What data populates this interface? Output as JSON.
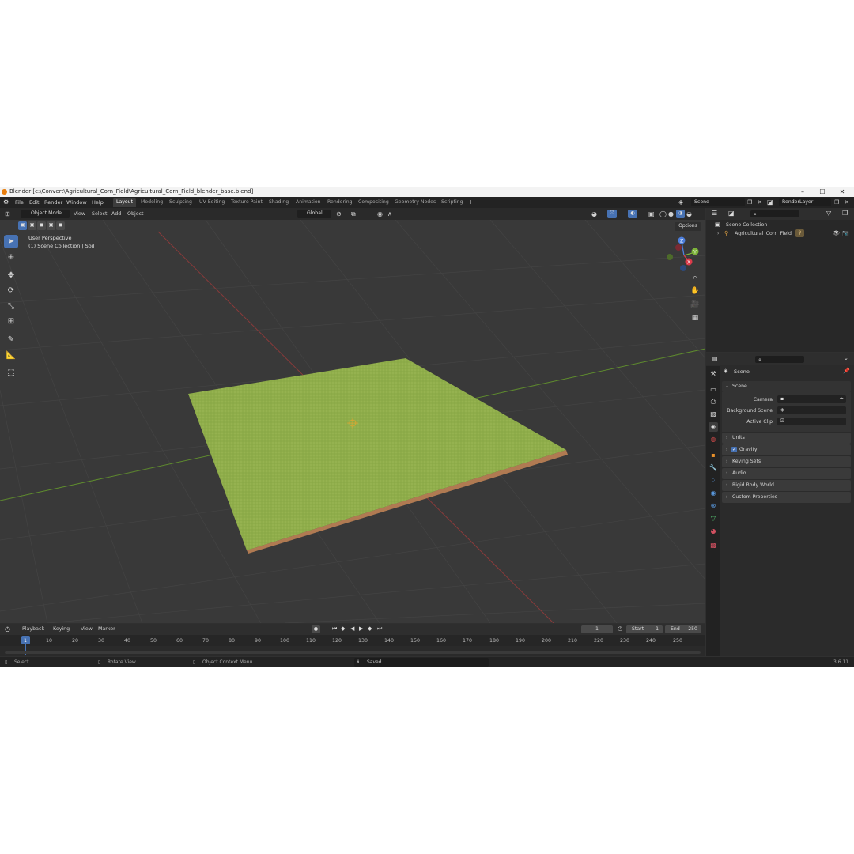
{
  "window": {
    "title": "Blender [c:\\Convert\\Agricultural_Corn_Field\\Agricultural_Corn_Field_blender_base.blend]",
    "minimize": "–",
    "maximize": "☐",
    "close": "✕"
  },
  "menu": [
    "File",
    "Edit",
    "Render",
    "Window",
    "Help"
  ],
  "workspaces": [
    {
      "label": "Layout",
      "active": true
    },
    {
      "label": "Modeling",
      "active": false
    },
    {
      "label": "Sculpting",
      "active": false
    },
    {
      "label": "UV Editing",
      "active": false
    },
    {
      "label": "Texture Paint",
      "active": false
    },
    {
      "label": "Shading",
      "active": false
    },
    {
      "label": "Animation",
      "active": false
    },
    {
      "label": "Rendering",
      "active": false
    },
    {
      "label": "Compositing",
      "active": false
    },
    {
      "label": "Geometry Nodes",
      "active": false
    },
    {
      "label": "Scripting",
      "active": false
    }
  ],
  "add_workspace": "+",
  "scene_selector": "Scene",
  "view_layer_selector": "RenderLayer",
  "viewport": {
    "mode": "Object Mode",
    "menus": [
      "View",
      "Select",
      "Add",
      "Object"
    ],
    "transform_orientation": "Global",
    "options_label": "Options",
    "overlay_line1": "User Perspective",
    "overlay_line2": "(1) Scene Collection | Soil",
    "gizmo": {
      "z": "Z",
      "y": "Y",
      "x": "X"
    }
  },
  "outliner": {
    "root": "Scene Collection",
    "items": [
      {
        "label": "Agricultural_Corn_Field"
      }
    ]
  },
  "properties": {
    "header": "Scene",
    "panel_title": "Scene",
    "fields": [
      {
        "label": "Camera",
        "value": ""
      },
      {
        "label": "Background Scene",
        "value": ""
      },
      {
        "label": "Active Clip",
        "value": ""
      }
    ],
    "collapsed_panels": [
      "Units",
      "Gravity",
      "Keying Sets",
      "Audio",
      "Rigid Body World",
      "Custom Properties"
    ],
    "gravity_checked": true
  },
  "timeline": {
    "menus": [
      "Playback",
      "Keying",
      "View",
      "Marker"
    ],
    "current_frame": "1",
    "start_label": "Start",
    "start": "1",
    "end_label": "End",
    "end": "250",
    "ticks": [
      "1",
      "10",
      "20",
      "30",
      "40",
      "50",
      "60",
      "70",
      "80",
      "90",
      "100",
      "110",
      "120",
      "130",
      "140",
      "150",
      "160",
      "170",
      "180",
      "190",
      "200",
      "210",
      "220",
      "230",
      "240",
      "250"
    ]
  },
  "status": {
    "left": "Select",
    "middle": "Rotate View",
    "right": "Object Context Menu",
    "message": "Saved \"Agricultural_Corn_Field_blender_base.blend\"",
    "version": "3.6.11"
  },
  "colors": {
    "accent": "#4772b3",
    "grass": "#8fad4a",
    "soil": "#b07a52"
  }
}
